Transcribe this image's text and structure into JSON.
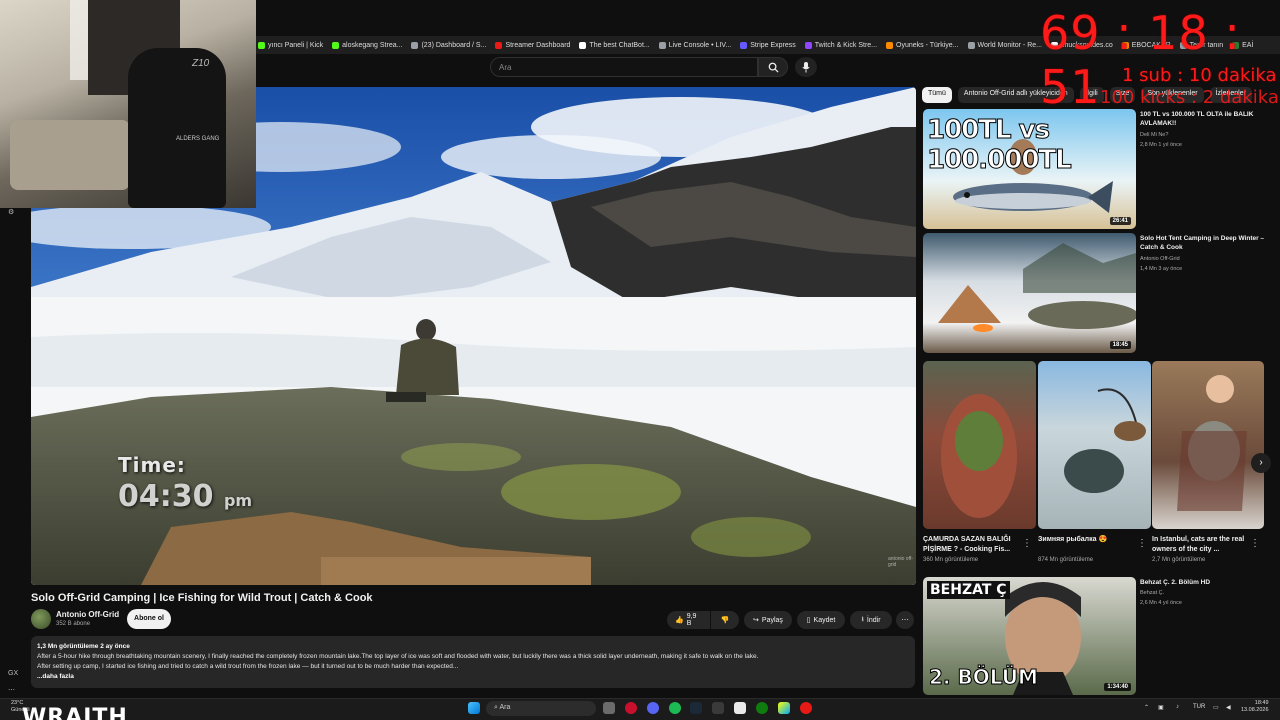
{
  "bookmarks": [
    {
      "label": "yıncı Paneli | Kick",
      "color": "#53fc18"
    },
    {
      "label": "aloskegang Strea...",
      "color": "#53fc18"
    },
    {
      "label": "(23) Dashboard / S...",
      "color": "#9aa0a6"
    },
    {
      "label": "Streamer Dashboard",
      "color": "#e91916"
    },
    {
      "label": "The best ChatBot...",
      "color": "#ffffff"
    },
    {
      "label": "Live Console • LIV...",
      "color": "#9aa0a6"
    },
    {
      "label": "Stripe Express",
      "color": "#635bff"
    },
    {
      "label": "Twitch & Kick Stre...",
      "color": "#9146ff"
    },
    {
      "label": "Oyuneks - Türkiye...",
      "color": "#ff8a00"
    },
    {
      "label": "World Monitor - Re...",
      "color": "#9aa0a6"
    },
    {
      "label": "chucksguides.co",
      "color": "#ffffff"
    },
    {
      "label": "EBOCAKER",
      "color": "#ff8a00"
    },
    {
      "label": "Terör tanın",
      "color": "#9aa0a6"
    },
    {
      "label": "EAİ",
      "color": "#2e7d32"
    }
  ],
  "search": {
    "placeholder": "Ara"
  },
  "timer": {
    "value": "69 : 18 : 51",
    "line1": "1 sub : 10 dakika",
    "line2": "100 kicks : 2 dakika"
  },
  "player": {
    "overlay_label": "Time:",
    "overlay_time": "04:30",
    "overlay_ampm": "pm",
    "watermark": "antonio off-grid"
  },
  "video": {
    "title": "Solo Off-Grid Camping | Ice Fishing for Wild Trout | Catch & Cook",
    "channel": "Antonio Off-Grid",
    "subscribers": "352 B abone",
    "subscribe_label": "Abone ol",
    "likes": "9,9 B",
    "share_label": "Paylaş",
    "save_label": "Kaydet",
    "download_label": "İndir",
    "views_date": "1,3 Mn görüntüleme  2 ay önce",
    "desc_line1": "After a 5-hour hike through breathtaking mountain scenery, I finally reached the completely frozen mountain lake.The top layer of ice was soft and flooded with water, but luckily there was a thick solid layer underneath, making it safe to walk on the lake.",
    "desc_line2": "After setting up camp, I started ice fishing and tried to catch a wild trout from the frozen lake — but it turned out to be much harder than expected...",
    "more": "...daha fazla"
  },
  "chips": [
    "Tümü",
    "Antonio Off-Grid adlı yükleyiciden",
    "İlgili",
    "Size",
    "Son yüklenenler",
    "İzlenenler"
  ],
  "recommendations": [
    {
      "title": "100 TL vs 100.000 TL OLTA ile BALIK AVLAMAK!!",
      "channel": "Deli Mi Ne?",
      "meta": "2,8 Mn  1 yıl önce",
      "duration": "26:41",
      "thumb_text": "100TL vs 100.000TL"
    },
    {
      "title": "Solo Hot Tent Camping in Deep Winter – Catch & Cook",
      "channel": "Antonio Off-Grid",
      "meta": "1,4 Mn  3 ay önce",
      "duration": "18:45"
    },
    {
      "title": "Behzat Ç. 2. Bölüm HD",
      "channel": "Behzat Ç.",
      "meta": "2,6 Mn  4 yıl önce",
      "duration": "1:34:40",
      "thumb_top": "BEHZAT Ç",
      "thumb_bottom": "2. BÖLÜM"
    }
  ],
  "shorts": [
    {
      "title": "ÇAMURDA SAZAN BALIĞI PİŞİRME ? - Cooking Fis...",
      "meta": "360 Mn görüntüleme"
    },
    {
      "title": "Зимняя рыбалка 😍",
      "meta": "874 Mn görüntüleme"
    },
    {
      "title": "In Istanbul, cats are the real owners of the city ...",
      "meta": "2,7 Mn görüntüleme"
    }
  ],
  "webcam": {
    "chair_logo": "Z10",
    "chair_text": "ALDERS GANG"
  },
  "taskbar": {
    "weather_temp": "23°C",
    "weather_desc": "Güneşli",
    "search": "Ara",
    "lang": "TUR",
    "time": "18:49",
    "date": "13.08.2026",
    "brand": "WRAITH"
  },
  "rail": {
    "gx": "GX"
  }
}
